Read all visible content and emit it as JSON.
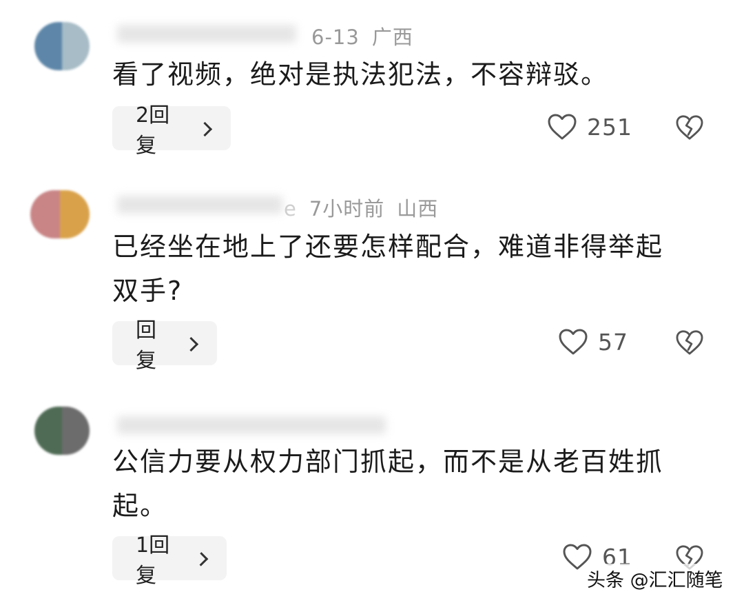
{
  "comments": [
    {
      "meta_date": "6-13",
      "meta_location": "广西",
      "text": "看了视频，绝对是执法犯法，不容辩驳。",
      "reply_label": "2回复",
      "like_count": "251",
      "avatar_colors": [
        "#5d86a8",
        "#a7bcc6"
      ]
    },
    {
      "meta_prefix": "e",
      "meta_date": "7小时前",
      "meta_location": "山西",
      "text": "已经坐在地上了还要怎样配合，难道非得举起双手?",
      "reply_label": "回复",
      "like_count": "57",
      "avatar_colors": [
        "#c98586",
        "#d9a24a"
      ]
    },
    {
      "meta_date": "",
      "meta_location": "",
      "text": "公信力要从权力部门抓起，而不是从老百姓抓起。",
      "reply_label": "1回复",
      "like_count": "61",
      "avatar_colors": [
        "#4f6b55",
        "#6c6c6c"
      ]
    }
  ],
  "watermark": "头条 @汇汇随笔",
  "icons": {
    "like": "heart-outline-icon",
    "dislike": "broken-heart-icon",
    "reply": "chevron-right-icon"
  },
  "colors": {
    "meta_text": "#999999",
    "reply_bg": "#f3f3f3",
    "icon_stroke": "#555555"
  }
}
